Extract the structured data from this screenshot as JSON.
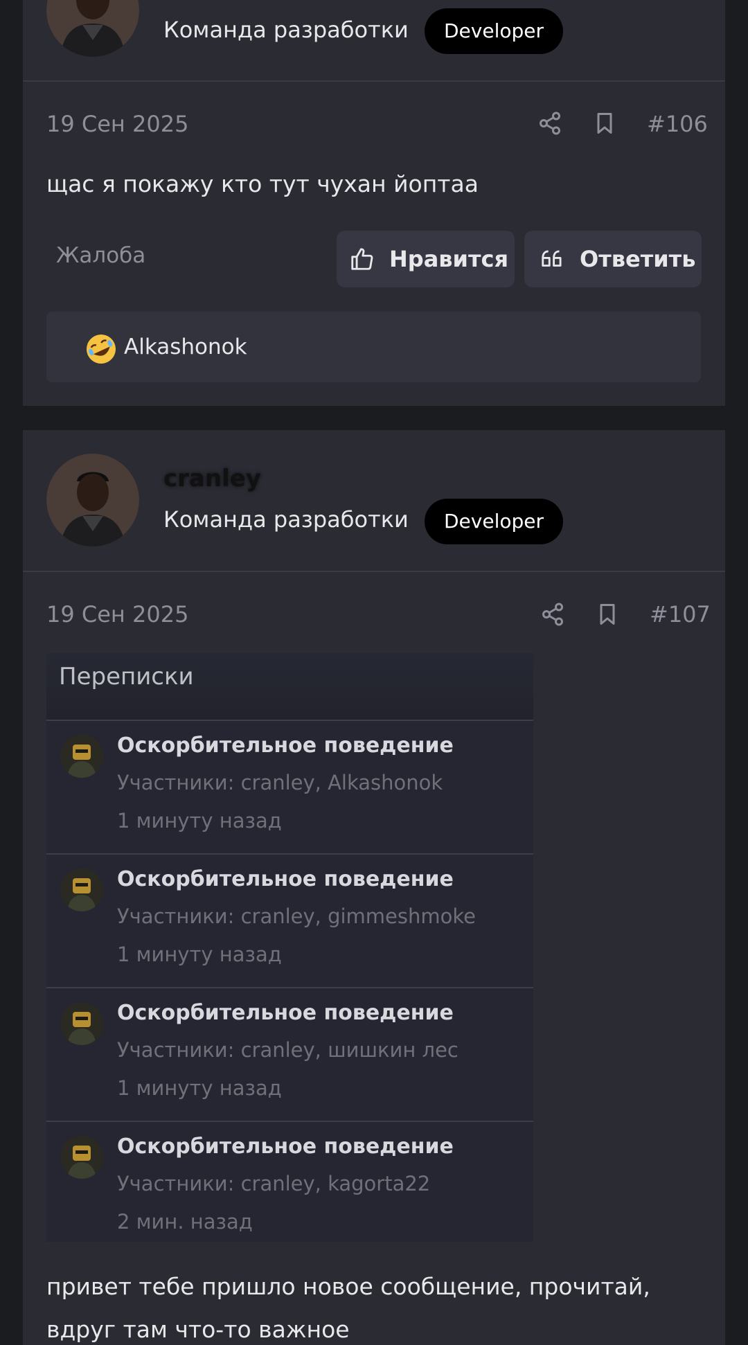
{
  "posts": [
    {
      "team": "Команда разработки",
      "role": "Developer",
      "date": "19 Сен 2025",
      "number": "#106",
      "text": "щас я покажу кто тут чухан йоптаа",
      "report_label": "Жалоба",
      "like_label": "Нравится",
      "reply_label": "Ответить",
      "reaction_user": "Alkashonok"
    },
    {
      "username": "cranley",
      "team": "Команда разработки",
      "role": "Developer",
      "date": "19 Сен 2025",
      "number": "#107",
      "screenshot": {
        "title": "Переписки",
        "items": [
          {
            "title": "Оскорбительное поведение",
            "members": "Участники: cranley, Alkashonok",
            "time": "1 минуту назад"
          },
          {
            "title": "Оскорбительное поведение",
            "members": "Участники: cranley, gimmeshmoke",
            "time": "1 минуту назад"
          },
          {
            "title": "Оскорбительное поведение",
            "members": "Участники: cranley, шишкин лес",
            "time": "1 минуту назад"
          },
          {
            "title": "Оскорбительное поведение",
            "members": "Участники: cranley, kagorta22",
            "time": "2 мин. назад"
          }
        ]
      },
      "text_line1": "привет тебе пришло новое сообщение, прочитай,",
      "text_line2": "вдруг там что-то важное"
    }
  ],
  "colors": {
    "background": "#1b1c20",
    "card": "#2a2b33",
    "badge": "#000000",
    "muted_text": "#8d8f99"
  },
  "icons": [
    "share-icon",
    "bookmark-icon",
    "thumbs-up-icon",
    "quote-icon",
    "rofl-emoji-icon"
  ]
}
